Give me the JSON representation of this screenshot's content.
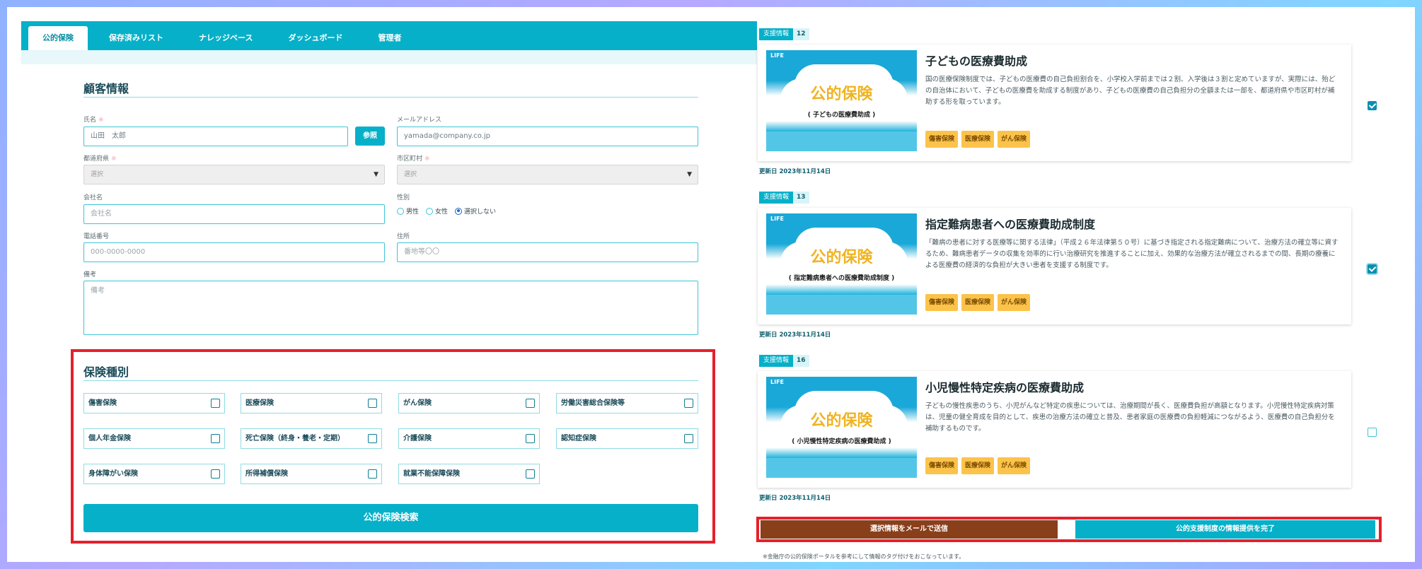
{
  "tabs": [
    "公的保険",
    "保存済みリスト",
    "ナレッジベース",
    "ダッシュボード",
    "管理者"
  ],
  "customer": {
    "title": "顧客情報",
    "name_label": "氏名",
    "name_value": "山田　太郎",
    "ref_button": "参照",
    "email_label": "メールアドレス",
    "email_value": "yamada@company.co.jp",
    "pref_label": "都道府県",
    "pref_value": "選択",
    "city_label": "市区町村",
    "city_value": "選択",
    "company_label": "会社名",
    "company_placeholder": "会社名",
    "gender_label": "性別",
    "gender_options": [
      "男性",
      "女性",
      "選択しない"
    ],
    "gender_selected": "選択しない",
    "phone_label": "電話番号",
    "phone_placeholder": "000-0000-0000",
    "address_label": "住所",
    "address_placeholder": "番地等〇〇",
    "memo_label": "備考",
    "memo_placeholder": "備考",
    "required_mark": "※"
  },
  "insurance": {
    "title": "保険種別",
    "types": [
      "傷害保険",
      "医療保険",
      "がん保険",
      "労働災害総合保険等",
      "個人年金保険",
      "死亡保険（終身・養老・定期）",
      "介護保険",
      "認知症保険",
      "身体障がい保険",
      "所得補償保険",
      "就業不能保障保険"
    ],
    "search_button": "公的保険検索"
  },
  "cards": [
    {
      "badge": "支援情報",
      "number": "12",
      "logo": "LIFE",
      "thumb_title": "公的保険",
      "thumb_sub": "( 子どもの医療費助成 )",
      "title": "子どもの医療費助成",
      "body": "国の医療保険制度では、子どもの医療費の自己負担割合を、小学校入学前までは２割、入学後は３割と定めていますが、実際には、殆どの自治体において、子どもの医療費を助成する制度があり、子どもの医療費の自己負担分の全額または一部を、都道府県や市区町村が補助する形を取っています。",
      "tags": [
        "傷害保険",
        "医療保険",
        "がん保険"
      ],
      "updated": "更新日 2023年11月14日",
      "checked": true
    },
    {
      "badge": "支援情報",
      "number": "13",
      "logo": "LIFE",
      "thumb_title": "公的保険",
      "thumb_sub": "( 指定難病患者への医療費助成制度 )",
      "title": "指定難病患者への医療費助成制度",
      "body": "「難病の患者に対する医療等に関する法律」（平成２６年法律第５０号）に基づき指定される指定難病について、治療方法の確立等に資するため、難病患者データの収集を効率的に行い治療研究を推進することに加え、効果的な治療方法が確立されるまでの間、長期の療養による医療費の経済的な負担が大きい患者を支援する制度です。",
      "tags": [
        "傷害保険",
        "医療保険",
        "がん保険"
      ],
      "updated": "更新日 2023年11月14日",
      "checked": true
    },
    {
      "badge": "支援情報",
      "number": "16",
      "logo": "LIFE",
      "thumb_title": "公的保険",
      "thumb_sub": "( 小児慢性特定疾病の医療費助成 )",
      "title": "小児慢性特定疾病の医療費助成",
      "body": "子どもの慢性疾患のうち、小児がんなど特定の疾患については、治療期間が長く、医療費負担が高額となります。小児慢性特定疾病対策は、児童の健全育成を目的として、疾患の治療方法の確立と普及、患者家庭の医療費の負担軽減につながるよう、医療費の自己負担分を補助するものです。",
      "tags": [
        "傷害保険",
        "医療保険",
        "がん保険"
      ],
      "updated": "更新日 2023年11月14日",
      "checked": false
    }
  ],
  "actions": {
    "mail_button": "選択情報をメールで送信",
    "done_button": "公的支援制度の情報提供を完了"
  },
  "footnote": "※金融庁の公的保険ポータルを参考にして情報のタグ付けをおこなっています。"
}
